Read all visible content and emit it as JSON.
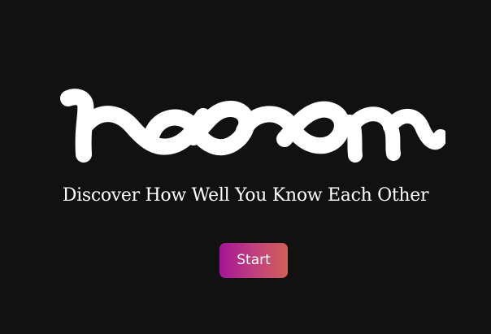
{
  "app": {
    "logo_text": "room",
    "tagline": "Discover How Well You Know Each Other",
    "start_label": "Start"
  },
  "colors": {
    "background": "#111111",
    "text": "#ffffff",
    "button_gradient_start": "#a51496",
    "button_gradient_end": "#d25f58"
  }
}
